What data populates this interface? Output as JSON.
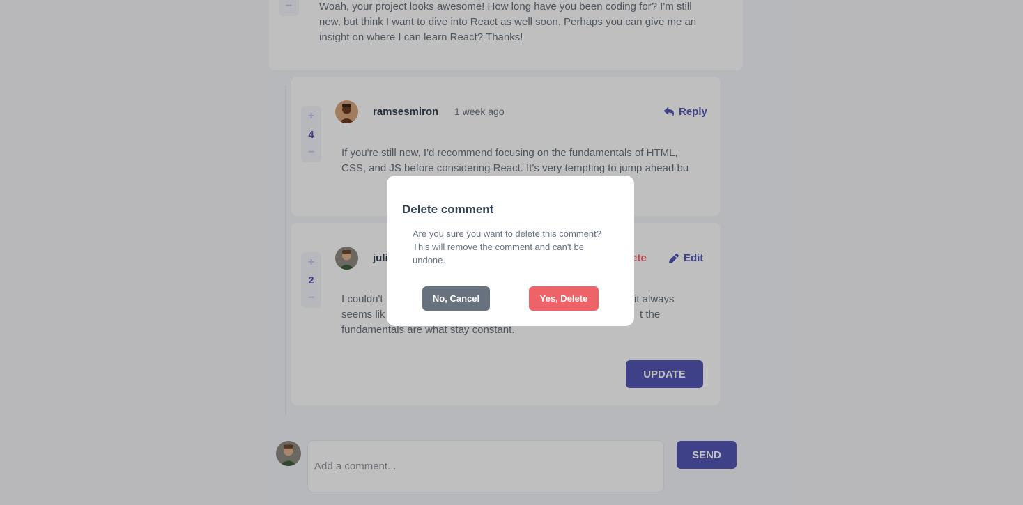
{
  "top_comment": {
    "score": "",
    "text": "Woah, your project looks awesome! How long have you been coding for? I'm still new, but think I want to dive into React as well soon. Perhaps you can give me an insight on where I can learn React? Thanks!"
  },
  "reply1": {
    "username": "ramsesmiron",
    "time": "1 week ago",
    "score": "4",
    "reply_label": "Reply",
    "text": "If you're still new, I'd recommend focusing on the fundamentals of HTML, CSS, and JS before considering React. It's very tempting to jump ahead bu"
  },
  "reply2": {
    "username": "juli",
    "score": "2",
    "delete_label": "lete",
    "edit_label": "Edit",
    "text_line1_start": "I couldn't",
    "text_line1_end": "it always",
    "text_line2_start": "seems lik",
    "text_line2_end": "t the",
    "text_line3": "fundamentals are what stay constant.",
    "update_label": "UPDATE"
  },
  "vote_plus": "+",
  "vote_minus": "−",
  "add_comment": {
    "placeholder": "Add a comment...",
    "send_label": "SEND"
  },
  "modal": {
    "title": "Delete comment",
    "message": "Are you sure you want to delete this comment? This will remove the comment and can't be undone.",
    "cancel_label": "No, Cancel",
    "confirm_label": "Yes, Delete"
  },
  "colors": {
    "accent": "#5357b6",
    "danger": "#ed6368",
    "neutral_button": "#67727e"
  }
}
